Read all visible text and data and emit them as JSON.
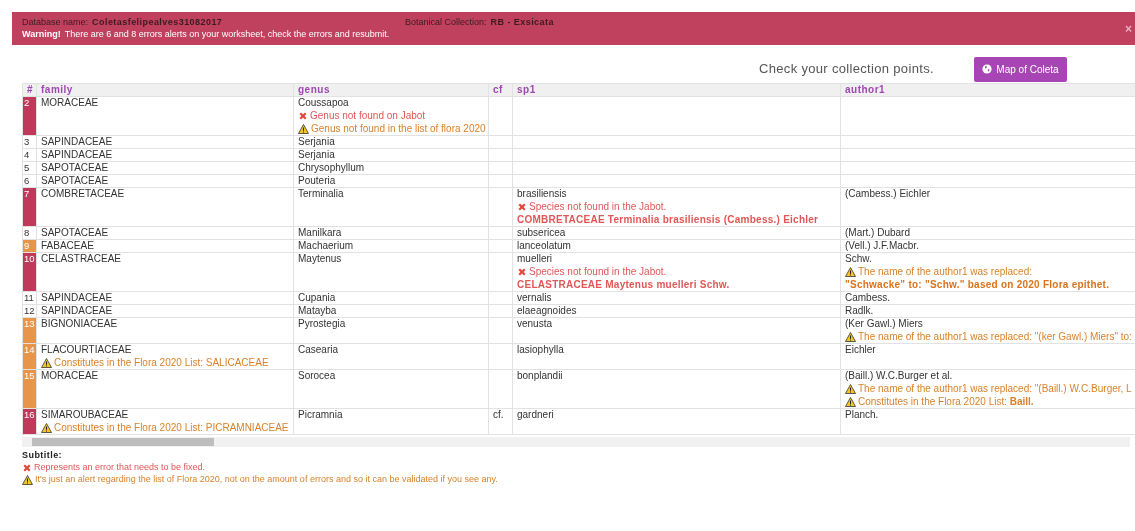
{
  "banner": {
    "database_label": "Database name:",
    "database_name": "Coletasfelipealves31082017",
    "collection_label": "Botanical Collection:",
    "collection_name": "RB - Exsicata",
    "warning_label": "Warning!",
    "warning_text": "There are 6 and 8 errors alerts on your worksheet, check the errors and resubmit.",
    "close": "×"
  },
  "map_prompt": "Check your collection points.",
  "map_button": "Map of Coleta",
  "table": {
    "columns": [
      "#",
      "family",
      "genus",
      "cf",
      "sp1",
      "author1"
    ],
    "rows": [
      {
        "number": "2",
        "color": "#c0395a",
        "family": "MORACEAE",
        "genus": "Coussapoa",
        "genus_notes": [
          {
            "kind": "error",
            "text": "Genus not found on Jabot"
          },
          {
            "kind": "alert",
            "text": "Genus not found in the list of flora 2020"
          }
        ]
      },
      {
        "number": "3",
        "family": "SAPINDACEAE",
        "genus": "Serjania"
      },
      {
        "number": "4",
        "family": "SAPINDACEAE",
        "genus": "Serjania"
      },
      {
        "number": "5",
        "family": "SAPOTACEAE",
        "genus": "Chrysophyllum"
      },
      {
        "number": "6",
        "family": "SAPOTACEAE",
        "genus": "Pouteria"
      },
      {
        "number": "7",
        "color": "#c0395a",
        "family": "COMBRETACEAE",
        "genus": "Terminalia",
        "sp1": "brasiliensis",
        "sp1_notes": [
          {
            "kind": "error",
            "text": "Species not found in the Jabot."
          },
          {
            "kind": "error_detail",
            "text": "COMBRETACEAE Terminalia brasiliensis (Cambess.) Eichler"
          }
        ],
        "author1": "(Cambess.) Eichler"
      },
      {
        "number": "8",
        "family": "SAPOTACEAE",
        "genus": "Manilkara",
        "sp1": "subsericea",
        "author1": "(Mart.) Dubard"
      },
      {
        "number": "9",
        "color": "#e8954a",
        "family": "FABACEAE",
        "genus": "Machaerium",
        "sp1": "lanceolatum",
        "author1": "(Vell.) J.F.Macbr."
      },
      {
        "number": "10",
        "color": "#c0395a",
        "family": "CELASTRACEAE",
        "genus": "Maytenus",
        "sp1": "muelleri",
        "sp1_notes": [
          {
            "kind": "error",
            "text": "Species not found in the Jabot."
          },
          {
            "kind": "error_detail",
            "text": "CELASTRACEAE Maytenus muelleri Schw."
          }
        ],
        "author1": "Schw.",
        "author1_notes": [
          {
            "kind": "alert",
            "text": "The name of the author1 was replaced:"
          },
          {
            "kind": "alert_detail",
            "text": "\"Schwacke\" to: \"Schw.\" based on 2020 Flora epithet."
          }
        ]
      },
      {
        "number": "11",
        "family": "SAPINDACEAE",
        "genus": "Cupania",
        "sp1": "vernalis",
        "author1": "Cambess."
      },
      {
        "number": "12",
        "family": "SAPINDACEAE",
        "genus": "Matayba",
        "sp1": "elaeagnoides",
        "author1": "Radlk."
      },
      {
        "number": "13",
        "color": "#e8954a",
        "family": "BIGNONIACEAE",
        "genus": "Pyrostegia",
        "sp1": "venusta",
        "author1": "(Ker Gawl.) Miers",
        "author1_notes": [
          {
            "kind": "alert",
            "text": "The name of the author1 was replaced: \"(ker Gawl.) Miers\" to:"
          }
        ]
      },
      {
        "number": "14",
        "color": "#e8954a",
        "family": "FLACOURTIACEAE",
        "family_notes": [
          {
            "kind": "alert",
            "text": "Constitutes in the Flora 2020 List: SALICACEAE"
          }
        ],
        "genus": "Casearia",
        "sp1": "lasiophylla",
        "author1": "Eichler"
      },
      {
        "number": "15",
        "color": "#e8954a",
        "family": "MORACEAE",
        "genus": "Sorocea",
        "sp1": "bonplandii",
        "author1": "(Baill.) W.C.Burger et al.",
        "author1_notes": [
          {
            "kind": "alert",
            "text": "The name of the author1 was replaced: \"(Baill.) W.C.Burger, L"
          },
          {
            "kind": "alert",
            "text": "Constitutes in the Flora 2020 List: **Baill.**"
          }
        ]
      },
      {
        "number": "16",
        "color": "#c0395a",
        "family": "SIMAROUBACEAE",
        "family_notes": [
          {
            "kind": "alert",
            "text": "Constitutes in the Flora 2020 List: PICRAMNIACEAE"
          }
        ],
        "genus": "Picramnia",
        "cf": "cf.",
        "sp1": "gardneri",
        "author1": "Planch."
      }
    ]
  },
  "legend": {
    "title": "Subtitle:",
    "items": [
      {
        "kind": "error",
        "text": "Represents an error that needs to be fixed."
      },
      {
        "kind": "alert",
        "text": "It's just an alert regarding the list of Flora 2020, not on the amount of errors and so it can be validated if you see any."
      }
    ]
  }
}
